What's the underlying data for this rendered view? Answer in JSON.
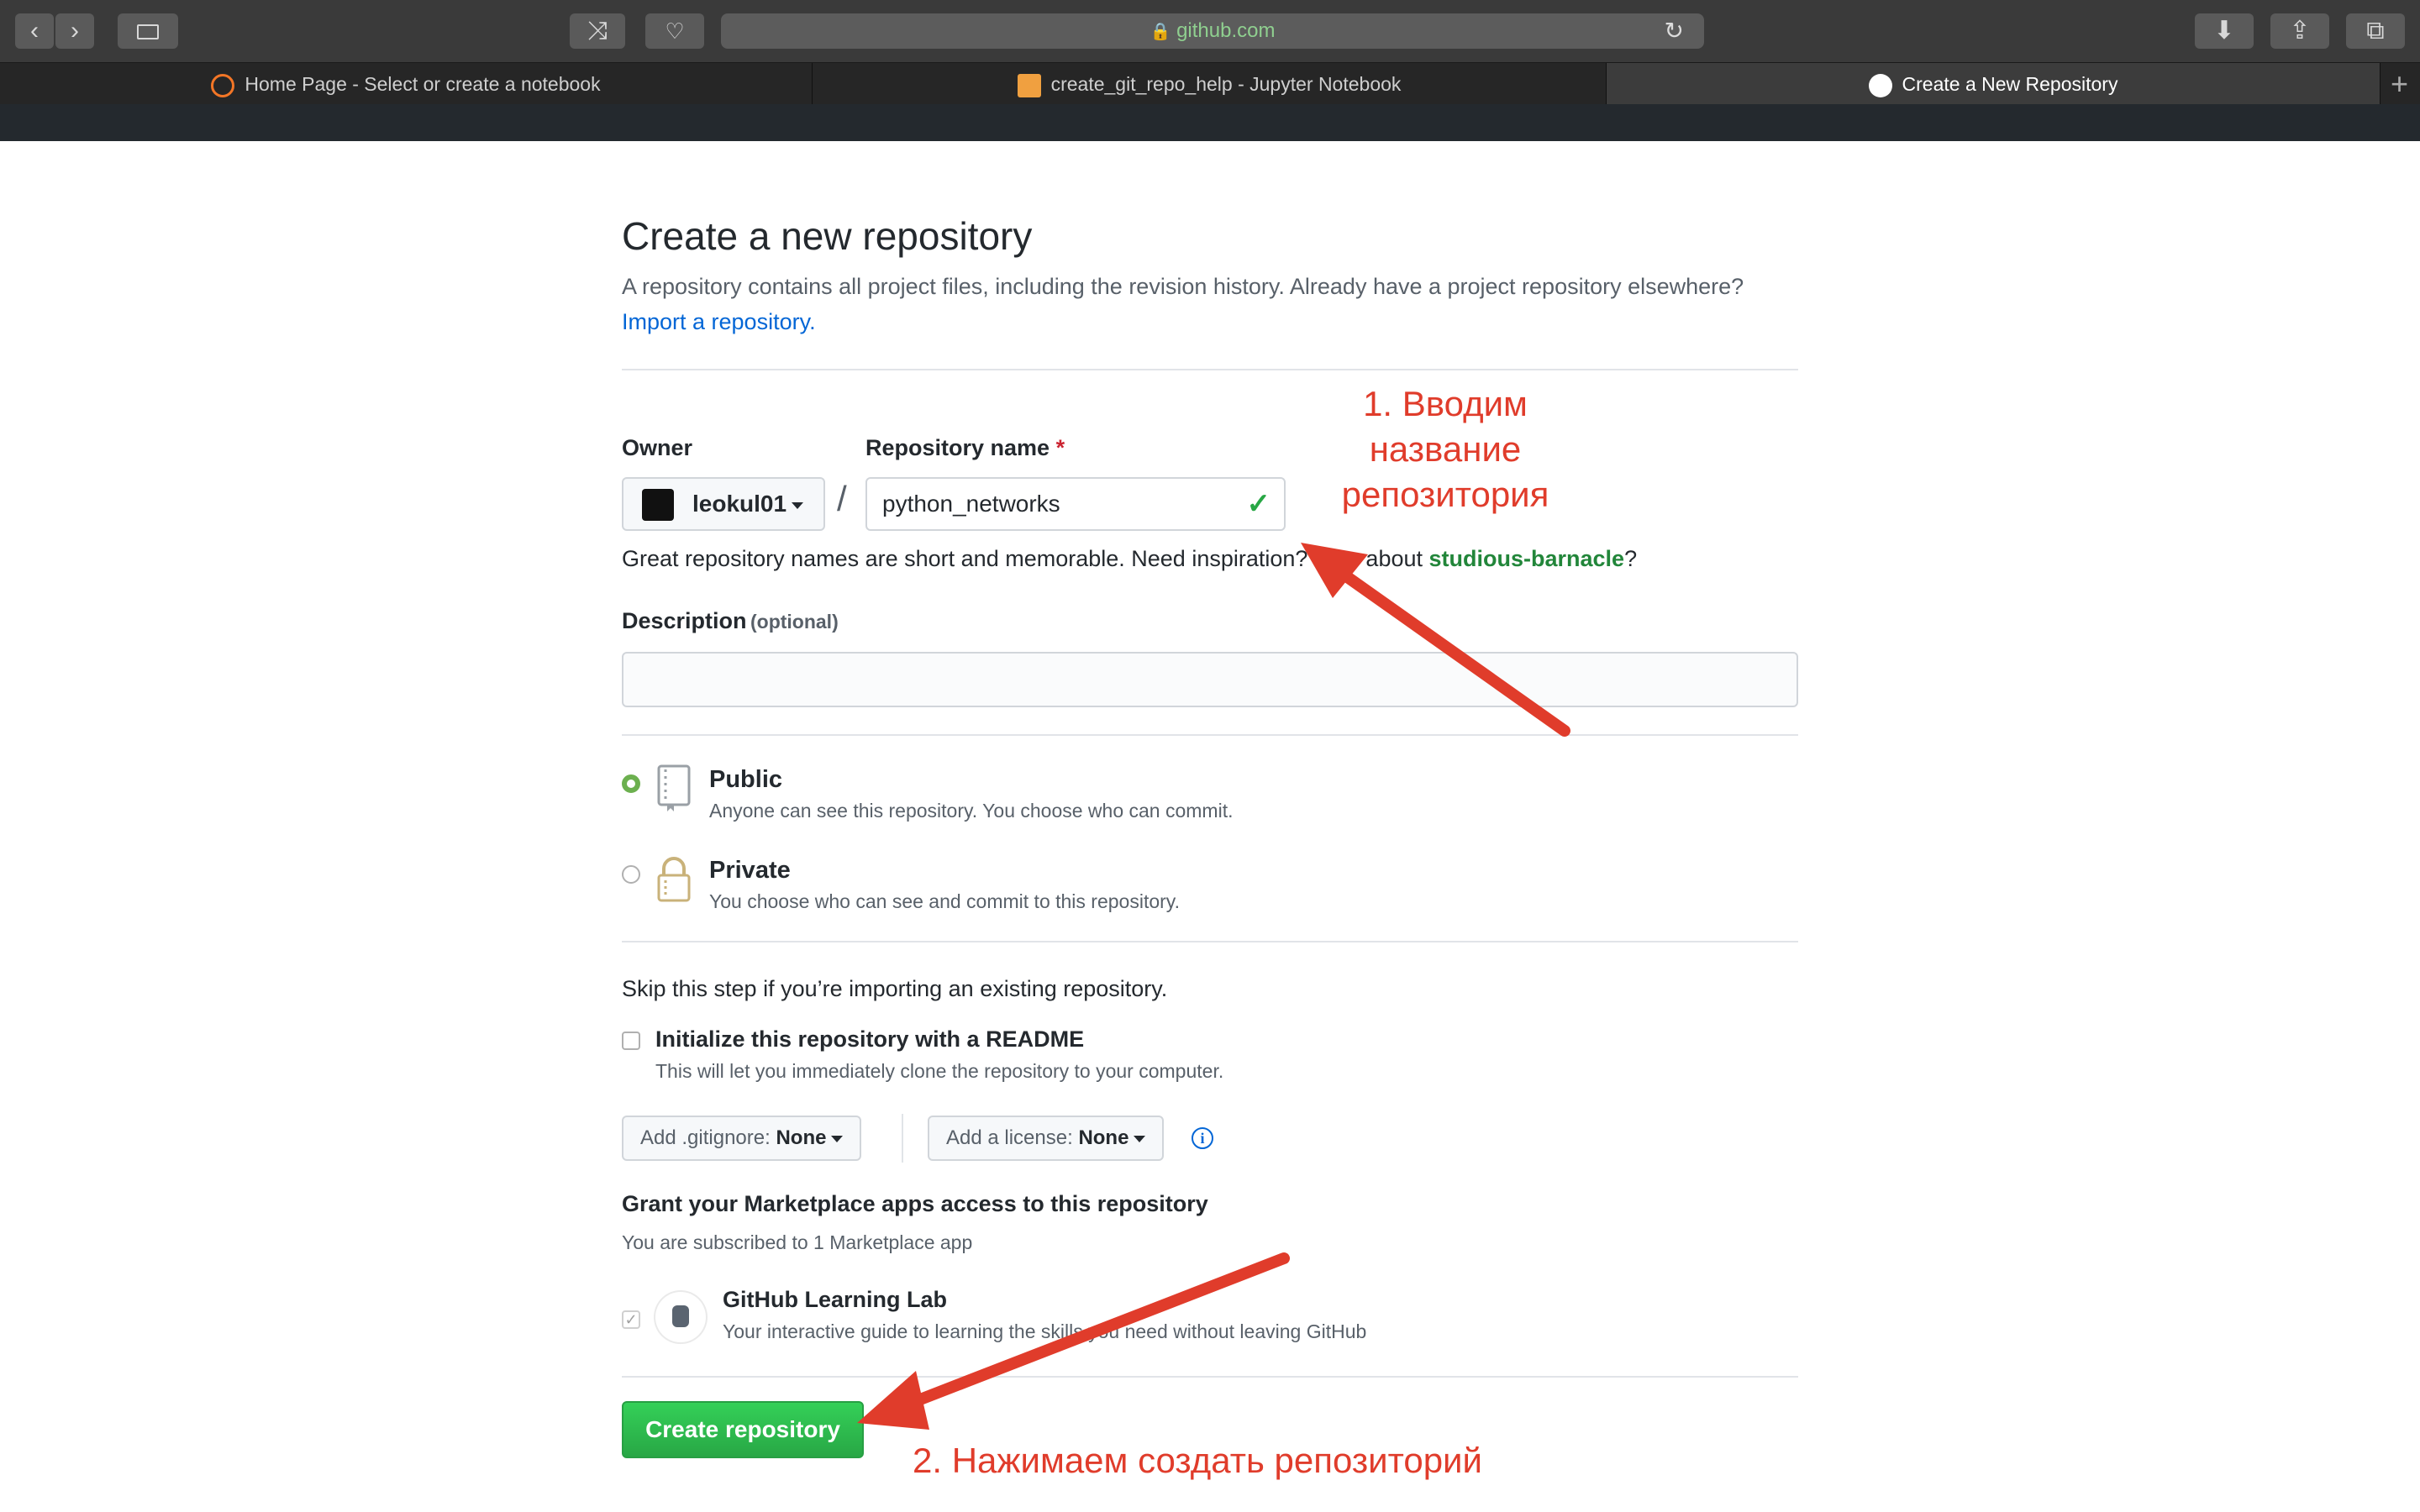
{
  "browser": {
    "url": "github.com",
    "tabs": [
      {
        "label": "Home Page - Select or create a notebook"
      },
      {
        "label": "create_git_repo_help - Jupyter Notebook"
      },
      {
        "label": "Create a New Repository"
      }
    ],
    "new_tab": "+"
  },
  "page": {
    "title": "Create a new repository",
    "subtitle": "A repository contains all project files, including the revision history. Already have a project repository elsewhere?",
    "import_link": "Import a repository."
  },
  "form": {
    "owner_label": "Owner",
    "owner_value": "leokul01",
    "repo_label": "Repository name",
    "required_mark": "*",
    "slash": "/",
    "repo_value": "python_networks",
    "help_text": "Great repository names are short and memorable. Need inspiration? How about",
    "suggestion": "studious-barnacle",
    "help_end": "?",
    "description_label": "Description",
    "description_optional": "(optional)",
    "description_value": ""
  },
  "visibility": {
    "public_title": "Public",
    "public_note": "Anyone can see this repository. You choose who can commit.",
    "private_title": "Private",
    "private_note": "You choose who can see and commit to this repository.",
    "selected": "public"
  },
  "init": {
    "skip_text": "Skip this step if you’re importing an existing repository.",
    "readme_label": "Initialize this repository with a README",
    "readme_note": "This will let you immediately clone the repository to your computer.",
    "gitignore_label": "Add .gitignore:",
    "gitignore_value": "None",
    "license_label": "Add a license:",
    "license_value": "None",
    "info_glyph": "i"
  },
  "marketplace": {
    "heading": "Grant your Marketplace apps access to this repository",
    "subtext": "You are subscribed to 1 Marketplace app",
    "app_name": "GitHub Learning Lab",
    "app_desc": "Your interactive guide to learning the skills you need without leaving GitHub"
  },
  "actions": {
    "create_label": "Create repository"
  },
  "annotations": {
    "step1": [
      "1. Вводим",
      "название",
      "репозитория"
    ],
    "step2": "2. Нажимаем создать репозиторий"
  },
  "colors": {
    "primary_green": "#2ea44f",
    "link_blue": "#0366d6",
    "annotation_red": "#e03c2b",
    "radio_green": "#6cb04f"
  }
}
